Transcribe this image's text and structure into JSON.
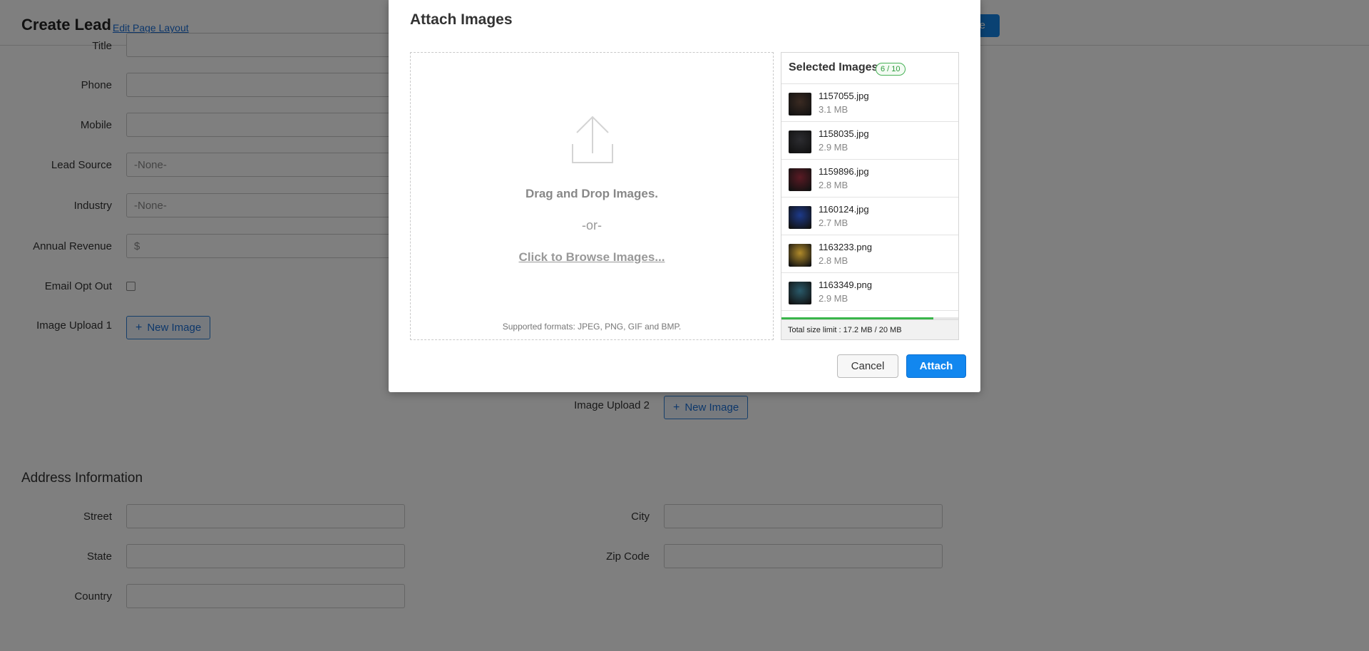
{
  "header": {
    "title": "Create Lead",
    "edit_layout": "Edit Page Layout",
    "save_label": "e"
  },
  "form": {
    "title_label": "Title",
    "phone_label": "Phone",
    "mobile_label": "Mobile",
    "lead_source_label": "Lead Source",
    "lead_source_value": "-None-",
    "industry_label": "Industry",
    "industry_value": "-None-",
    "annual_revenue_label": "Annual Revenue",
    "annual_revenue_prefix": "$",
    "email_opt_out_label": "Email Opt Out",
    "image_upload_1_label": "Image Upload 1",
    "image_upload_2_label": "Image Upload 2",
    "new_image_label": "New Image"
  },
  "address": {
    "section_title": "Address Information",
    "street_label": "Street",
    "city_label": "City",
    "state_label": "State",
    "zip_label": "Zip Code",
    "country_label": "Country"
  },
  "modal": {
    "title": "Attach Images",
    "drop_text": "Drag and Drop Images.",
    "or_text": "-or-",
    "browse_text": "Click to Browse Images...",
    "formats_text": "Supported formats: JPEG, PNG, GIF and BMP.",
    "selected_title": "Selected Images",
    "selected_count": "6 / 10",
    "files": [
      {
        "name": "1157055.jpg",
        "size": "3.1 MB",
        "thumb_color": "#3a2a22"
      },
      {
        "name": "1158035.jpg",
        "size": "2.9 MB",
        "thumb_color": "#2c2c30"
      },
      {
        "name": "1159896.jpg",
        "size": "2.8 MB",
        "thumb_color": "#5a1a24"
      },
      {
        "name": "1160124.jpg",
        "size": "2.7 MB",
        "thumb_color": "#1d3a8a"
      },
      {
        "name": "1163233.png",
        "size": "2.8 MB",
        "thumb_color": "#b08a2a"
      },
      {
        "name": "1163349.png",
        "size": "2.9 MB",
        "thumb_color": "#2a5a6a"
      }
    ],
    "size_used_fraction": 0.86,
    "size_limit_text": "Total size limit : 17.2 MB / 20 MB",
    "cancel_label": "Cancel",
    "attach_label": "Attach"
  },
  "colors": {
    "accent": "#1287ef",
    "progress": "#39b54a",
    "badge": "#2e9b3e"
  }
}
